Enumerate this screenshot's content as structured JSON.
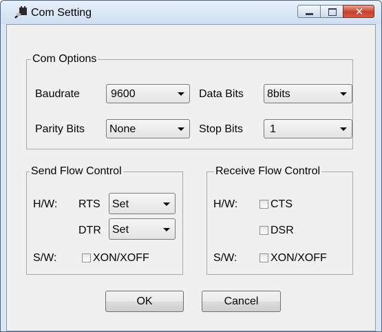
{
  "window": {
    "title": "Com Setting",
    "close_glyph": "✕"
  },
  "com_options": {
    "title": "Com Options",
    "baudrate": {
      "label": "Baudrate",
      "value": "9600"
    },
    "data_bits": {
      "label": "Data Bits",
      "value": "8bits"
    },
    "parity_bits": {
      "label": "Parity Bits",
      "value": "None"
    },
    "stop_bits": {
      "label": "Stop Bits",
      "value": "1"
    }
  },
  "send_flow": {
    "title": "Send Flow Control",
    "hw_label": "H/W:",
    "rts_label": "RTS",
    "rts_value": "Set",
    "dtr_label": "DTR",
    "dtr_value": "Set",
    "sw_label": "S/W:",
    "xon_label": "XON/XOFF",
    "xon_checked": false
  },
  "receive_flow": {
    "title": "Receive Flow Control",
    "hw_label": "H/W:",
    "cts_label": "CTS",
    "cts_checked": false,
    "dsr_label": "DSR",
    "dsr_checked": false,
    "sw_label": "S/W:",
    "xon_label": "XON/XOFF",
    "xon_checked": false
  },
  "buttons": {
    "ok": "OK",
    "cancel": "Cancel"
  },
  "icons": {
    "app": "plug-icon",
    "minimize": "minimize-icon",
    "maximize": "maximize-icon",
    "close": "close-icon"
  }
}
